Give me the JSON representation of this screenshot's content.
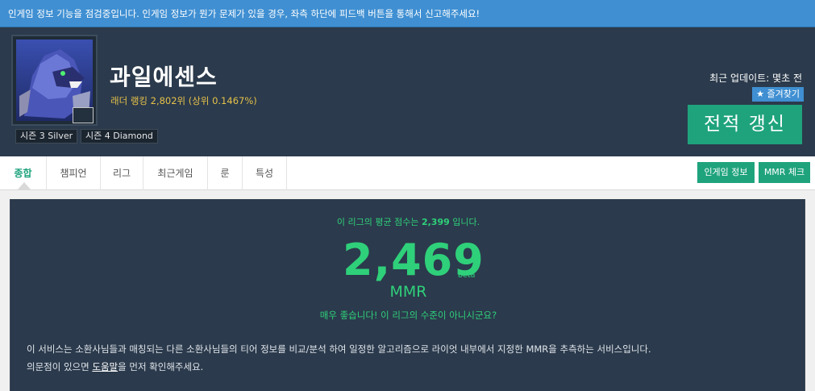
{
  "notice": "인게임 정보 기능을 점검중입니다. 인게임 정보가 뭔가 문제가 있을 경우, 좌측 하단에 피드백 버튼을 통해서 신고해주세요!",
  "profile": {
    "name": "과일에센스",
    "ladder": "래더 랭킹 2,802위 (상위 0.1467%)",
    "seasons": [
      "시즌 3 Silver",
      "시즌 4 Diamond"
    ],
    "update_time": "최근 업데이트: 몇초 전",
    "favorite_label": "★ 즐겨찾기",
    "refresh_label": "전적 갱신"
  },
  "tabs": [
    "종합",
    "챔피언",
    "리그",
    "최근게임",
    "룬",
    "특성"
  ],
  "actions": {
    "ingame": "인게임 정보",
    "mmr_check": "MMR 체크"
  },
  "mmr": {
    "avg_prefix": "이 리그의 평균 점수는 ",
    "avg_value": "2,399",
    "avg_suffix": " 입니다.",
    "value": "2,469",
    "beta": "beta",
    "label": "MMR",
    "comment": "매우 좋습니다! 이 리그의 수준이 아니시군요?"
  },
  "description": {
    "line1": "이 서비스는 소환사님들과 매칭되는 다른 소환사님들의 티어 정보를 비교/분석 하여 일정한 알고리즘으로 라이엇 내부에서 지정한 MMR을 추측하는 서비스입니다.",
    "line2_prefix": "의문점이 있으면 ",
    "help_link": "도움말",
    "line2_suffix": "을 먼저 확인해주세요."
  },
  "colors": {
    "notice_bg": "#3f8fd2",
    "header_bg": "#2b3a4c",
    "accent_green": "#1fa37d",
    "mmr_green": "#2fd07a",
    "ladder_gold": "#e6c14a"
  }
}
